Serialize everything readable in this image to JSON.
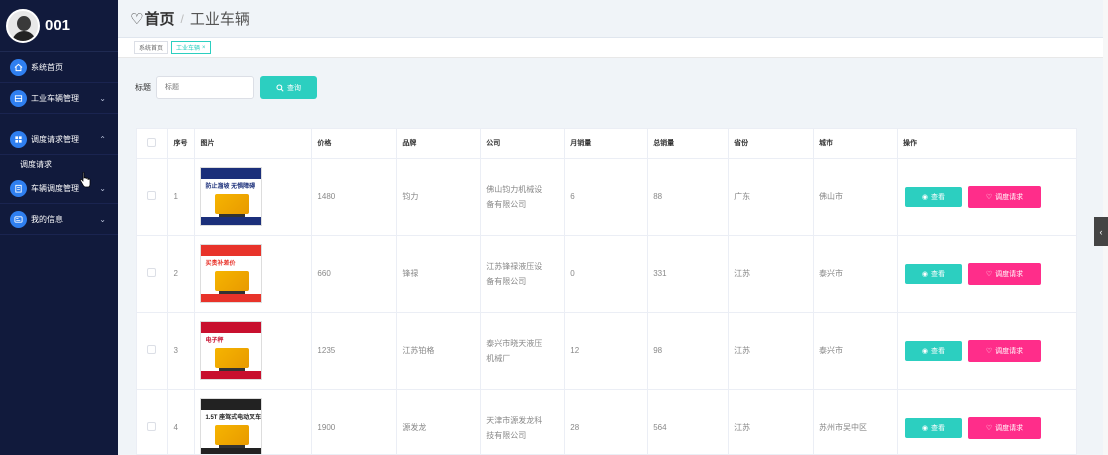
{
  "sidebar": {
    "username": "001",
    "items": [
      {
        "label": "系统首页",
        "icon": "home-icon",
        "has_caret": false
      },
      {
        "label": "工业车辆管理",
        "icon": "grid-icon",
        "has_caret": true
      },
      {
        "label": "调度请求管理",
        "icon": "apps-icon",
        "has_caret": true,
        "expanded": true
      },
      {
        "label": "车辆调度管理",
        "icon": "clipboard-icon",
        "has_caret": true
      },
      {
        "label": "我的信息",
        "icon": "id-card-icon",
        "has_caret": true
      }
    ],
    "submenu": {
      "label": "调度请求"
    }
  },
  "header": {
    "home": "首页",
    "separator": "/",
    "page": "工业车辆"
  },
  "tabs": [
    {
      "label": "系统首页",
      "active": false
    },
    {
      "label": "工业车辆",
      "active": true,
      "close": "×"
    }
  ],
  "search": {
    "label": "标题",
    "placeholder": "标题",
    "button": "查询"
  },
  "table": {
    "headers": [
      "",
      "序号",
      "图片",
      "价格",
      "品牌",
      "公司",
      "月销量",
      "总销量",
      "省份",
      "城市",
      "操作"
    ],
    "view_label": "查看",
    "request_label": "调度请求",
    "rows": [
      {
        "no": "1",
        "price": "1480",
        "brand": "钧力",
        "company": "佛山钧力机械设备有限公司",
        "monthly": "6",
        "total": "88",
        "province": "广东",
        "city": "佛山市",
        "img_text": "防止溜坡 无惧障碍",
        "img_color": "#1b2f7a"
      },
      {
        "no": "2",
        "price": "660",
        "brand": "锋禄",
        "company": "江苏锋禄液压设备有限公司",
        "monthly": "0",
        "total": "331",
        "province": "江苏",
        "city": "泰兴市",
        "img_text": "买贵补差价",
        "img_color": "#e8332a"
      },
      {
        "no": "3",
        "price": "1235",
        "brand": "江苏铂格",
        "company": "泰兴市晓天液压机械厂",
        "monthly": "12",
        "total": "98",
        "province": "江苏",
        "city": "泰兴市",
        "img_text": "电子秤",
        "img_color": "#c8102e"
      },
      {
        "no": "4",
        "price": "1900",
        "brand": "源发龙",
        "company": "天津市源发龙科技有限公司",
        "monthly": "28",
        "total": "564",
        "province": "江苏",
        "city": "苏州市吴中区",
        "img_text": "1.5T 座驾式电动叉车",
        "img_color": "#222222"
      }
    ]
  }
}
